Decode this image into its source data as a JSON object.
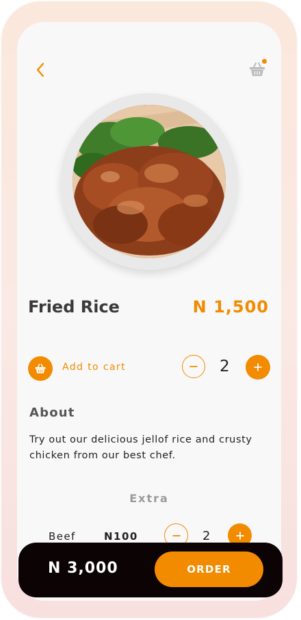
{
  "header": {
    "back_icon": "chevron-left-icon",
    "cart_icon": "basket-icon",
    "cart_has_notification": true
  },
  "product": {
    "name": "Fried Rice",
    "price": "N 1,500",
    "image": "grilled-chicken-plate"
  },
  "cart": {
    "add_label": "Add to cart",
    "quantity": "2"
  },
  "about": {
    "heading": "About",
    "text": "Try out our delicious jellof rice and crusty chicken from our best chef."
  },
  "extra": {
    "heading": "Extra",
    "items": [
      {
        "name": "Beef",
        "price": "N100",
        "quantity": "2"
      }
    ]
  },
  "order_bar": {
    "total": "N 3,000",
    "button_label": "ORDER"
  },
  "colors": {
    "accent": "#f28b00",
    "bar": "#0c0304",
    "background": "#f8f8f8"
  }
}
